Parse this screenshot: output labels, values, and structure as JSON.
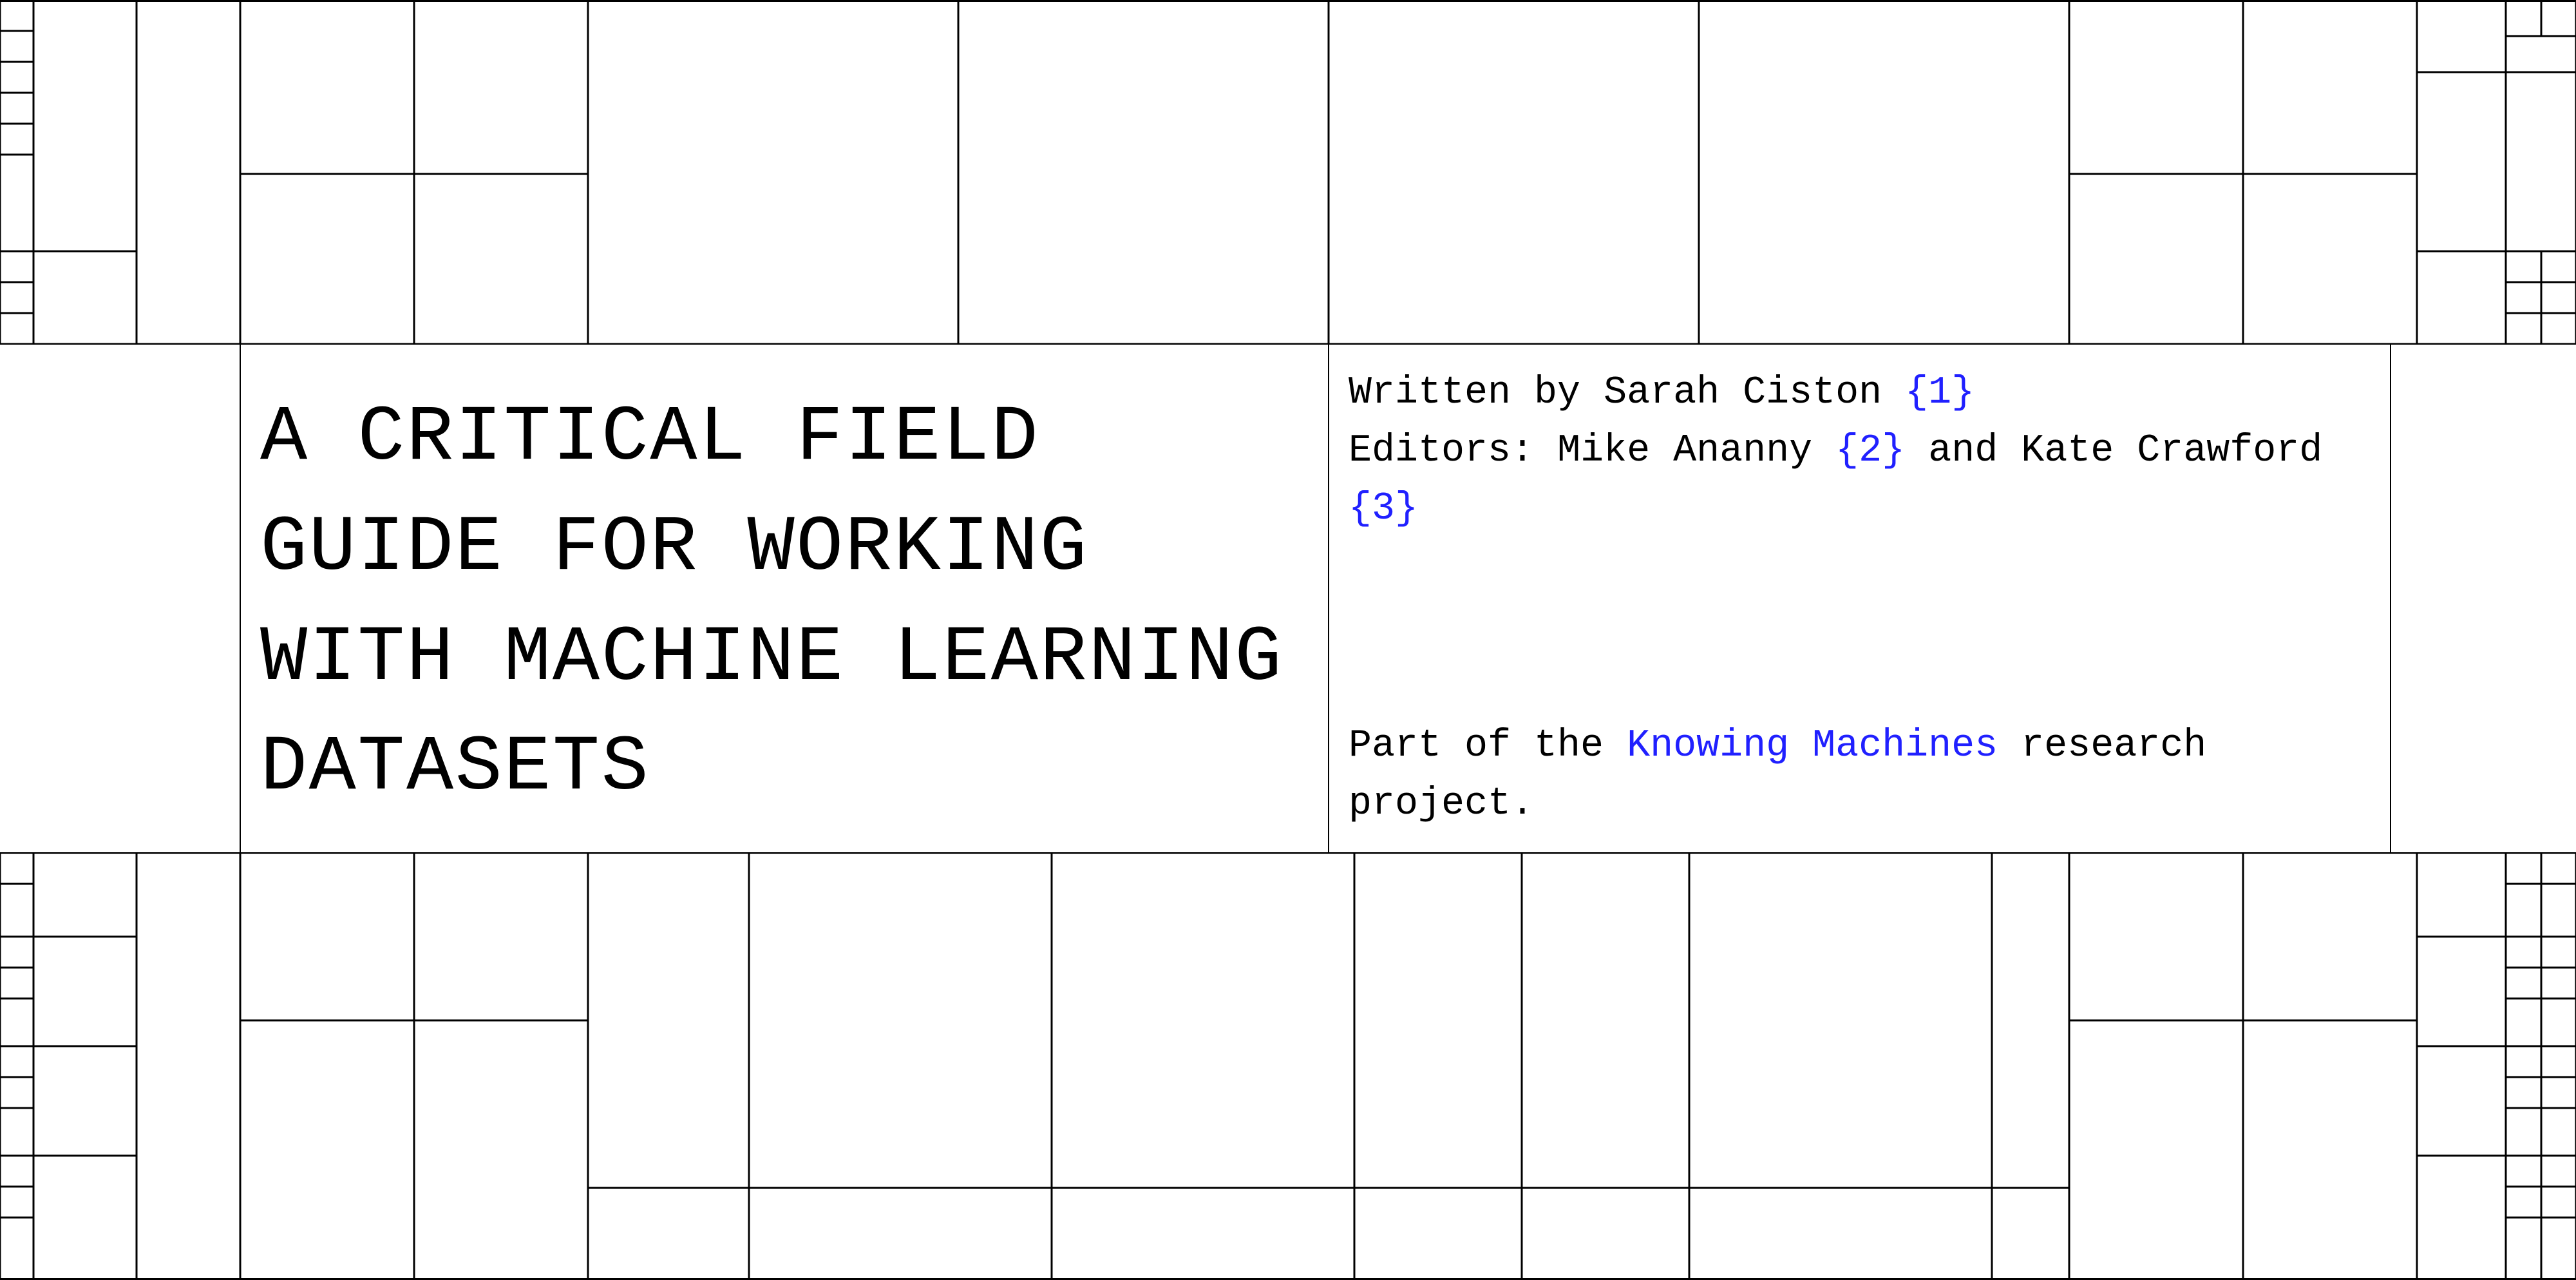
{
  "title": "A CRITICAL FIELD GUIDE FOR WORKING WITH MACHINE LEARNING DATASETS",
  "byline": {
    "written_prefix": "Written by ",
    "author": "Sarah Ciston",
    "author_ref": "{1}",
    "editors_prefix": "Editors: ",
    "editor1": "Mike Ananny",
    "editor1_ref": "{2}",
    "editors_joiner": " and ",
    "editor2": "Kate Crawford",
    "editor2_ref": "{3}"
  },
  "project": {
    "prefix": "Part of the ",
    "link_text": "Knowing Machines",
    "suffix": " research project."
  },
  "colors": {
    "link": "#2020ff",
    "border": "#000000",
    "background": "#ffffff"
  }
}
